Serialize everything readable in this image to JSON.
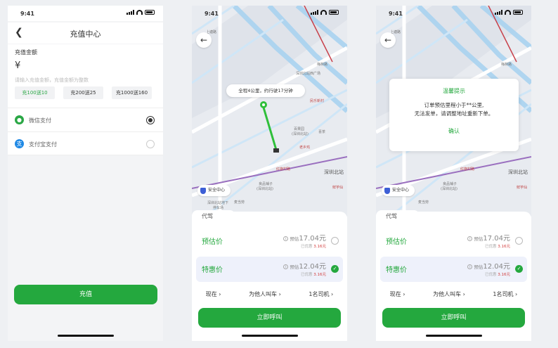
{
  "status": {
    "time": "9:41"
  },
  "recharge": {
    "title": "充值中心",
    "amount_label": "充值金额",
    "currency": "¥",
    "hint": "请输入充值金额，充值金额为整数",
    "options": [
      {
        "label": "充100送10",
        "selected": true
      },
      {
        "label": "充200送25",
        "selected": false
      },
      {
        "label": "充1000送160",
        "selected": false
      }
    ],
    "payments": [
      {
        "label": "微信支付",
        "icon": "wechat-pay-icon",
        "color": "#2aa745",
        "glyph": "✓",
        "selected": true
      },
      {
        "label": "支付宝支付",
        "icon": "alipay-icon",
        "color": "#1e88e5",
        "glyph": "支",
        "selected": false
      }
    ],
    "submit": "充值"
  },
  "map": {
    "trip_bubble": "全程4公里，约行驶17分钟",
    "safety": "安全中心",
    "pois": [
      {
        "t": "上塘路"
      },
      {
        "t": "梅林路"
      },
      {
        "t": "民乐新村"
      },
      {
        "t": "深圳北站"
      },
      {
        "t": "百果园"
      },
      {
        "t": "(深圳北站)"
      },
      {
        "t": "喜茶"
      },
      {
        "t": "良品铺子"
      },
      {
        "t": "(深圳北站)"
      },
      {
        "t": "麦当劳"
      },
      {
        "t": "深圳北站地下"
      },
      {
        "t": "停车场"
      },
      {
        "t": "老乡鸡"
      },
      {
        "t": "红旗村路"
      },
      {
        "t": "鲜芋仙"
      },
      {
        "t": "深圳北站西广场"
      }
    ]
  },
  "sheet": {
    "tab": "代驾",
    "rows": [
      {
        "name": "预估价",
        "est_label": "预估",
        "price": "17.04元",
        "disc_label": "已优惠",
        "disc": "3.16元",
        "selected": false
      },
      {
        "name": "特惠价",
        "est_label": "预估",
        "price": "12.04元",
        "disc_label": "已优惠",
        "disc": "3.16元",
        "selected": true
      }
    ],
    "opts": [
      "现在 ›",
      "为他人叫车 ›",
      "1名司机 ›"
    ],
    "call": "立即呼叫"
  },
  "dialog": {
    "title": "温馨提示",
    "body": "订单预估里程小于**公里,\n无法发单，请调整地址重新下单。",
    "ok": "确认"
  },
  "colors": {
    "brand_green": "#24a83e",
    "discount_red": "#d23c3c"
  }
}
